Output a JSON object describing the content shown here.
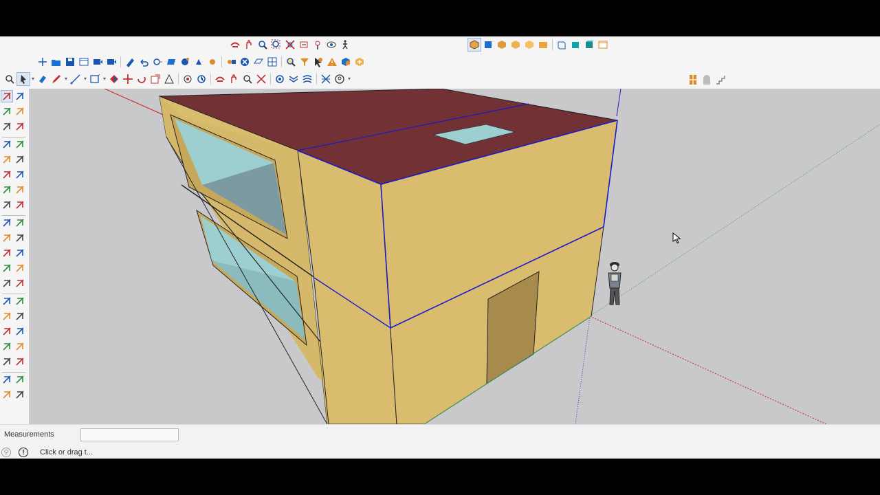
{
  "top_toolbar_1": {
    "icons": [
      "orbit-icon",
      "pan-icon",
      "zoom-icon",
      "zoom-window-icon",
      "zoom-extents-icon",
      "previous-view-icon",
      "position-camera-icon",
      "look-around-icon",
      "walk-icon"
    ]
  },
  "top_toolbar_2": {
    "icons": [
      "iso-view-icon",
      "top-view-icon",
      "front-view-icon",
      "right-view-icon",
      "back-view-icon",
      "left-view-icon",
      "bottom-view-icon",
      "xray-icon",
      "wireframe-icon"
    ]
  },
  "main_toolbar": {
    "icons": [
      "new-icon",
      "open-icon",
      "save-icon",
      "cut-icon",
      "copy-icon",
      "paste-icon",
      "erase-icon",
      "undo-icon",
      "redo-icon",
      "print-icon",
      "model-info-icon",
      "components-icon",
      "materials-icon",
      "styles-icon",
      "layers-icon",
      "scenes-icon",
      "shadows-icon",
      "fog-icon",
      "outliner-icon",
      "entity-info-icon",
      "search-icon",
      "filter-icon",
      "select-arrow-icon",
      "warning-icon",
      "extension-icon",
      "extension-manager-icon"
    ]
  },
  "tools_row": {
    "icons": [
      "search-icon",
      "select-icon",
      "eraser-icon",
      "pencil-icon",
      "line-icon",
      "rectangle-icon",
      "push-pull-icon",
      "move-icon",
      "rotate-icon",
      "scale-icon",
      "protractor-icon",
      "tape-icon",
      "dimension-icon",
      "orbit-icon",
      "pan-icon",
      "zoom-icon",
      "zoom-extents-icon",
      "section-plane-icon",
      "section-fill-icon",
      "sandbox-icon",
      "account-icon"
    ]
  },
  "right_panel_icons": [
    "window-icon",
    "door-icon",
    "stairs-icon"
  ],
  "left_toolbar": {
    "icons": [
      "select-icon",
      "lasso-icon",
      "paint-bucket-icon",
      "eraser-icon",
      "tag-icon",
      "eraser-alt-icon",
      "line-icon",
      "freehand-icon",
      "rectangle-icon",
      "rotated-rect-icon",
      "circle-icon",
      "polygon-icon",
      "arc-icon",
      "two-point-arc-icon",
      "pie-icon",
      "three-point-arc-icon",
      "move-icon",
      "push-pull-icon",
      "rotate-icon",
      "follow-me-icon",
      "scale-icon",
      "offset-icon",
      "tape-measure-icon",
      "dimension-icon",
      "protractor-icon",
      "text-icon",
      "axes-icon",
      "3d-text-icon",
      "orbit-icon",
      "pan-icon",
      "zoom-icon",
      "zoom-window-icon",
      "zoom-extents-icon",
      "previous-icon",
      "position-camera-icon",
      "walk-icon",
      "look-around-icon",
      "section-plane-icon",
      "section-display-icon",
      "sandbox-icon"
    ]
  },
  "status_bar": {
    "measurements_label": "Measurements",
    "measurements_value": "",
    "hint": "Click or drag t..."
  },
  "colors": {
    "wall": "#d9bc6e",
    "roof": "#713135",
    "glass": "#9ecfd0",
    "door": "#a88a4d",
    "selection": "#1a1acc",
    "background": "#c9c9cc"
  }
}
